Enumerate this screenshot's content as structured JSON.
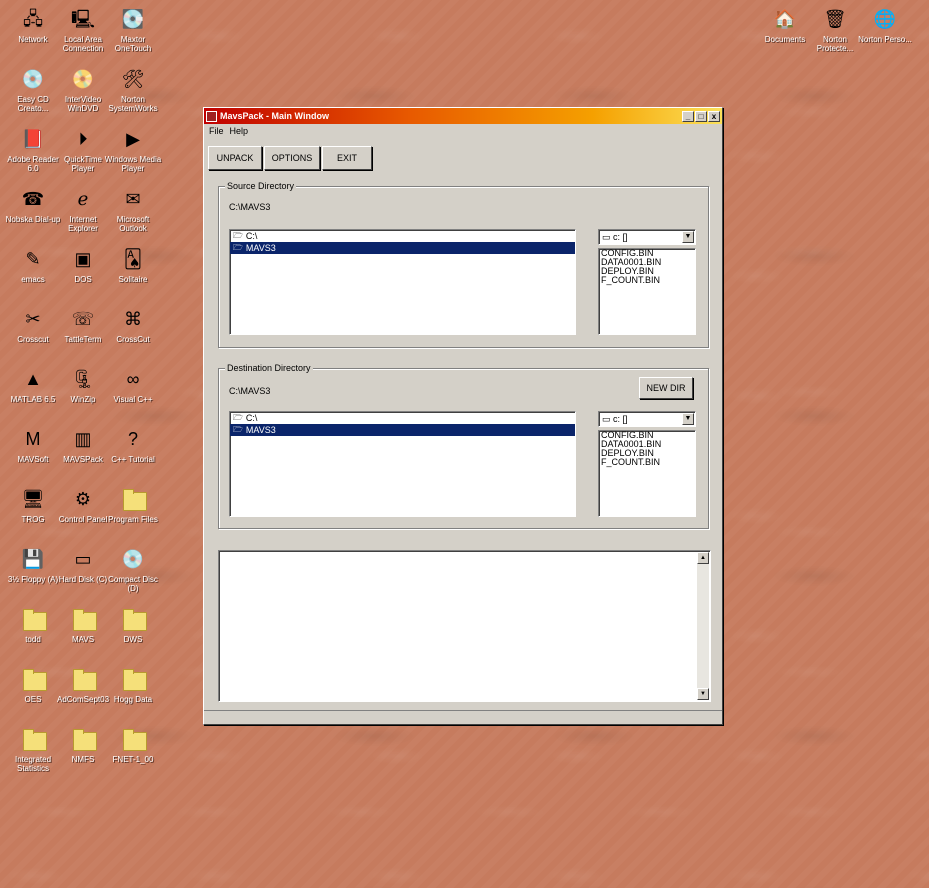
{
  "desktop": {
    "icons_left": [
      {
        "label": "Network",
        "icon": "network-icon",
        "glyph": "🖧"
      },
      {
        "label": "Local Area Connection",
        "icon": "network-connection-icon",
        "glyph": "🖳"
      },
      {
        "label": "Maxtor OneTouch",
        "icon": "maxtor-icon",
        "glyph": "💽"
      },
      {
        "label": "Easy CD Creato...",
        "icon": "cd-creator-icon",
        "glyph": "💿"
      },
      {
        "label": "InterVideo WinDVD",
        "icon": "windvd-icon",
        "glyph": "📀"
      },
      {
        "label": "Norton SystemWorks",
        "icon": "norton-systemworks-icon",
        "glyph": "🛠"
      },
      {
        "label": "Adobe Reader 6.0",
        "icon": "adobe-reader-icon",
        "glyph": "📕"
      },
      {
        "label": "QuickTime Player",
        "icon": "quicktime-icon",
        "glyph": "⏵"
      },
      {
        "label": "Windows Media Player",
        "icon": "media-player-icon",
        "glyph": "▶"
      },
      {
        "label": "Nobska Dial-up",
        "icon": "dialup-icon",
        "glyph": "☎"
      },
      {
        "label": "Internet Explorer",
        "icon": "internet-explorer-icon",
        "glyph": "ℯ"
      },
      {
        "label": "Microsoft Outlook",
        "icon": "outlook-icon",
        "glyph": "✉"
      },
      {
        "label": "emacs",
        "icon": "emacs-icon",
        "glyph": "✎"
      },
      {
        "label": "DOS",
        "icon": "dos-icon",
        "glyph": "▣"
      },
      {
        "label": "Solitaire",
        "icon": "solitaire-icon",
        "glyph": "🂡"
      },
      {
        "label": "Crosscut",
        "icon": "crosscut-icon",
        "glyph": "✂"
      },
      {
        "label": "TattleTerm",
        "icon": "tattleterm-icon",
        "glyph": "☏"
      },
      {
        "label": "CrossCut",
        "icon": "crosscut2-icon",
        "glyph": "⌘"
      },
      {
        "label": "MATLAB 6.5",
        "icon": "matlab-icon",
        "glyph": "▲"
      },
      {
        "label": "WinZip",
        "icon": "winzip-icon",
        "glyph": "🗜"
      },
      {
        "label": "Visual C++",
        "icon": "visual-cpp-icon",
        "glyph": "∞"
      },
      {
        "label": "MAVSoft",
        "icon": "mavsoft-icon",
        "glyph": "M"
      },
      {
        "label": "MAVSPack",
        "icon": "mavspack-icon",
        "glyph": "▥"
      },
      {
        "label": "C++ Tutorial",
        "icon": "help-icon",
        "glyph": "?"
      },
      {
        "label": "TROG",
        "icon": "computer-icon",
        "glyph": "🖥"
      },
      {
        "label": "Control Panel",
        "icon": "control-panel-icon",
        "glyph": "⚙"
      },
      {
        "label": "Program Files",
        "icon": "folder-icon",
        "glyph": ""
      },
      {
        "label": "3½ Floppy (A)",
        "icon": "floppy-icon",
        "glyph": "💾"
      },
      {
        "label": "Hard Disk (C)",
        "icon": "hard-disk-icon",
        "glyph": "▭"
      },
      {
        "label": "Compact Disc (D)",
        "icon": "cd-drive-icon",
        "glyph": "💿"
      },
      {
        "label": "todd",
        "icon": "folder-icon",
        "glyph": ""
      },
      {
        "label": "MAVS",
        "icon": "folder-icon",
        "glyph": ""
      },
      {
        "label": "DWS",
        "icon": "folder-icon",
        "glyph": ""
      },
      {
        "label": "OES",
        "icon": "folder-icon",
        "glyph": ""
      },
      {
        "label": "AdComSept03",
        "icon": "folder-icon",
        "glyph": ""
      },
      {
        "label": "Hogg Data",
        "icon": "folder-icon",
        "glyph": ""
      },
      {
        "label": "Integrated Statistics",
        "icon": "folder-icon",
        "glyph": ""
      },
      {
        "label": "NMFS",
        "icon": "folder-icon",
        "glyph": ""
      },
      {
        "label": "FNET-1_00",
        "icon": "folder-icon",
        "glyph": ""
      }
    ],
    "icons_right": [
      {
        "label": "Documents",
        "icon": "documents-icon",
        "glyph": "🏠"
      },
      {
        "label": "Norton Protecte...",
        "icon": "recycle-bin-icon",
        "glyph": "🗑"
      },
      {
        "label": "Norton Perso...",
        "icon": "globe-icon",
        "glyph": "🌐"
      }
    ]
  },
  "window": {
    "title": "MavsPack - Main Window",
    "controls": {
      "minimize": "_",
      "maximize": "□",
      "close": "x"
    },
    "menu": [
      "File",
      "Help"
    ],
    "toolbar": {
      "unpack": "UNPACK",
      "options": "OPTIONS",
      "exit": "EXIT"
    },
    "source": {
      "legend": "Source Directory",
      "path": "C:\\MAVS3",
      "dirs": [
        {
          "name": "C:\\",
          "selected": false
        },
        {
          "name": "MAVS3",
          "selected": true
        }
      ],
      "drive": "c: []",
      "files": [
        "CONFIG.BIN",
        "DATA0001.BIN",
        "DEPLOY.BIN",
        "F_COUNT.BIN"
      ]
    },
    "destination": {
      "legend": "Destination Directory",
      "path": "C:\\MAVS3",
      "new_dir": "NEW DIR",
      "dirs": [
        {
          "name": "C:\\",
          "selected": false
        },
        {
          "name": "MAVS3",
          "selected": true
        }
      ],
      "drive": "c: []",
      "files": [
        "CONFIG.BIN",
        "DATA0001.BIN",
        "DEPLOY.BIN",
        "F_COUNT.BIN"
      ]
    },
    "log_text": ""
  }
}
